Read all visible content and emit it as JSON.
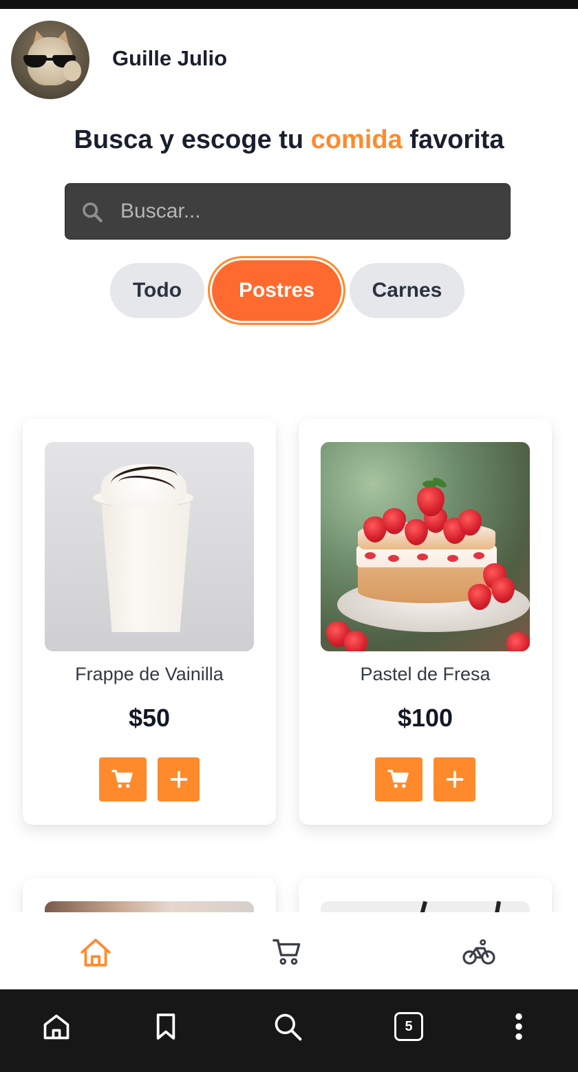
{
  "user": {
    "name": "Guille Julio"
  },
  "headline": {
    "part1": "Busca y escoge tu ",
    "accent": "comida",
    "part2": " favorita"
  },
  "search": {
    "placeholder": "Buscar..."
  },
  "categories": [
    {
      "label": "Todo",
      "active": false
    },
    {
      "label": "Postres",
      "active": true
    },
    {
      "label": "Carnes",
      "active": false
    }
  ],
  "products": [
    {
      "name": "Frappe de Vainilla",
      "price": "$50",
      "image_icon": "vanilla-frappe"
    },
    {
      "name": "Pastel de Fresa",
      "price": "$100",
      "image_icon": "strawberry-cake"
    }
  ],
  "app_nav": {
    "items": [
      {
        "icon": "home-icon",
        "active": true
      },
      {
        "icon": "cart-icon",
        "active": false
      },
      {
        "icon": "bicycle-icon",
        "active": false
      }
    ]
  },
  "system_nav": {
    "tab_count": "5"
  },
  "colors": {
    "accent": "#ff8a2b",
    "chip_active": "#ff6a2e",
    "chip_inactive": "#e6e7eb",
    "search_bg": "#3f3f3f",
    "system_bar": "#171717"
  }
}
